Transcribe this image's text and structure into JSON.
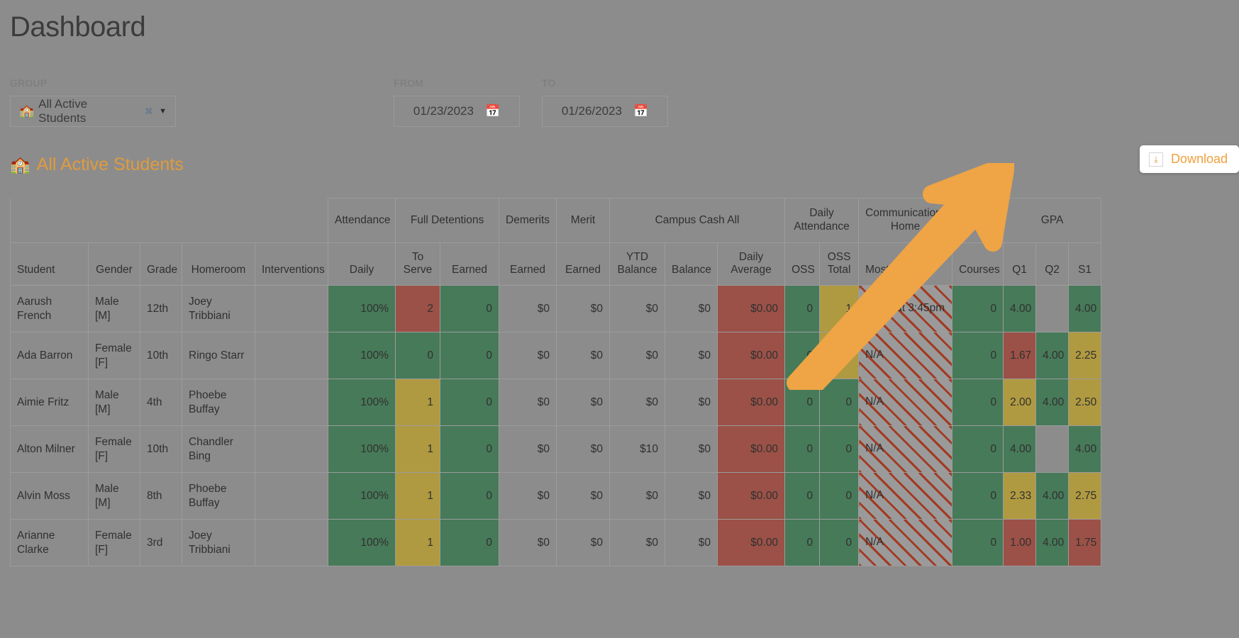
{
  "page": {
    "title": "Dashboard"
  },
  "filters": {
    "group": {
      "label": "GROUP",
      "value": "All Active Students",
      "icon": "school-building-icon",
      "clear": "✖",
      "caret": "▼"
    },
    "from": {
      "label": "FROM",
      "value": "01/23/2023",
      "icon": "calendar-icon"
    },
    "to": {
      "label": "TO",
      "value": "01/26/2023",
      "icon": "calendar-icon"
    }
  },
  "section": {
    "title": "All Active Students",
    "icon": "school-building-icon"
  },
  "download": {
    "label": "Download",
    "icon": "download-icon",
    "glyph": "⤓"
  },
  "table": {
    "group_headers": [
      {
        "label": "",
        "span": 5
      },
      {
        "label": "Attendance",
        "span": 1
      },
      {
        "label": "Full Detentions",
        "span": 2
      },
      {
        "label": "Demerits",
        "span": 1
      },
      {
        "label": "Merit",
        "span": 1
      },
      {
        "label": "Campus Cash All",
        "span": 3
      },
      {
        "label": "Daily Attendance",
        "span": 2
      },
      {
        "label": "Communications Home",
        "span": 1
      },
      {
        "label": "",
        "span": 1
      },
      {
        "label": "GPA",
        "span": 3
      }
    ],
    "columns": [
      "Student",
      "Gender",
      "Grade",
      "Homeroom",
      "Interventions",
      "Daily",
      "To Serve",
      "Earned",
      "Earned",
      "Earned",
      "YTD Balance",
      "Balance",
      "Daily Average",
      "OSS",
      "OSS Total",
      "Most Recent",
      "Courses",
      "Q1",
      "Q2",
      "S1"
    ],
    "rows": [
      {
        "student": "Aarush French",
        "gender": "Male [M]",
        "grade": "12th",
        "homeroom": "Joey Tribbiani",
        "interventions": "",
        "daily": "100%",
        "to_serve": "2",
        "det_earned": "0",
        "demerits": "$0",
        "merit": "$0",
        "ytd_balance": "$0",
        "balance": "$0",
        "daily_average": "$0.00",
        "oss": "0",
        "oss_total": "1",
        "most_recent": "10/21 at 3:45pm",
        "courses": "0",
        "q1": "4.00",
        "q2": "",
        "s1": "4.00",
        "colors": {
          "daily": "g",
          "to_serve": "r",
          "det_earned": "g",
          "daily_average": "r",
          "oss": "g",
          "oss_total": "y",
          "courses": "g",
          "q1": "g",
          "q2": "n",
          "s1": "g"
        }
      },
      {
        "student": "Ada Barron",
        "gender": "Female [F]",
        "grade": "10th",
        "homeroom": "Ringo Starr",
        "interventions": "",
        "daily": "100%",
        "to_serve": "0",
        "det_earned": "0",
        "demerits": "$0",
        "merit": "$0",
        "ytd_balance": "$0",
        "balance": "$0",
        "daily_average": "$0.00",
        "oss": "0",
        "oss_total": "1",
        "most_recent": "N/A",
        "courses": "0",
        "q1": "1.67",
        "q2": "4.00",
        "s1": "2.25",
        "colors": {
          "daily": "g",
          "to_serve": "g",
          "det_earned": "g",
          "daily_average": "r",
          "oss": "g",
          "oss_total": "y",
          "courses": "g",
          "q1": "r",
          "q2": "g",
          "s1": "y"
        }
      },
      {
        "student": "Aimie Fritz",
        "gender": "Male [M]",
        "grade": "4th",
        "homeroom": "Phoebe Buffay",
        "interventions": "",
        "daily": "100%",
        "to_serve": "1",
        "det_earned": "0",
        "demerits": "$0",
        "merit": "$0",
        "ytd_balance": "$0",
        "balance": "$0",
        "daily_average": "$0.00",
        "oss": "0",
        "oss_total": "0",
        "most_recent": "N/A",
        "courses": "0",
        "q1": "2.00",
        "q2": "4.00",
        "s1": "2.50",
        "colors": {
          "daily": "g",
          "to_serve": "y",
          "det_earned": "g",
          "daily_average": "r",
          "oss": "g",
          "oss_total": "g",
          "courses": "g",
          "q1": "y",
          "q2": "g",
          "s1": "y"
        }
      },
      {
        "student": "Alton Milner",
        "gender": "Female [F]",
        "grade": "10th",
        "homeroom": "Chandler Bing",
        "interventions": "",
        "daily": "100%",
        "to_serve": "1",
        "det_earned": "0",
        "demerits": "$0",
        "merit": "$0",
        "ytd_balance": "$10",
        "balance": "$0",
        "daily_average": "$0.00",
        "oss": "0",
        "oss_total": "0",
        "most_recent": "N/A",
        "courses": "0",
        "q1": "4.00",
        "q2": "",
        "s1": "4.00",
        "colors": {
          "daily": "g",
          "to_serve": "y",
          "det_earned": "g",
          "daily_average": "r",
          "oss": "g",
          "oss_total": "g",
          "courses": "g",
          "q1": "g",
          "q2": "n",
          "s1": "g"
        }
      },
      {
        "student": "Alvin Moss",
        "gender": "Male [M]",
        "grade": "8th",
        "homeroom": "Phoebe Buffay",
        "interventions": "",
        "daily": "100%",
        "to_serve": "1",
        "det_earned": "0",
        "demerits": "$0",
        "merit": "$0",
        "ytd_balance": "$0",
        "balance": "$0",
        "daily_average": "$0.00",
        "oss": "0",
        "oss_total": "0",
        "most_recent": "N/A",
        "courses": "0",
        "q1": "2.33",
        "q2": "4.00",
        "s1": "2.75",
        "colors": {
          "daily": "g",
          "to_serve": "y",
          "det_earned": "g",
          "daily_average": "r",
          "oss": "g",
          "oss_total": "g",
          "courses": "g",
          "q1": "y",
          "q2": "g",
          "s1": "y"
        }
      },
      {
        "student": "Arianne Clarke",
        "gender": "Female [F]",
        "grade": "3rd",
        "homeroom": "Joey Tribbiani",
        "interventions": "",
        "daily": "100%",
        "to_serve": "1",
        "det_earned": "0",
        "demerits": "$0",
        "merit": "$0",
        "ytd_balance": "$0",
        "balance": "$0",
        "daily_average": "$0.00",
        "oss": "0",
        "oss_total": "0",
        "most_recent": "N/A",
        "courses": "0",
        "q1": "1.00",
        "q2": "4.00",
        "s1": "1.75",
        "colors": {
          "daily": "g",
          "to_serve": "y",
          "det_earned": "g",
          "daily_average": "r",
          "oss": "g",
          "oss_total": "g",
          "courses": "g",
          "q1": "r",
          "q2": "g",
          "s1": "r"
        }
      }
    ]
  },
  "colors": {
    "accent_orange": "#e09b3d",
    "page_bg": "#8c8c8c",
    "green": "#477a59",
    "red": "#9b5147",
    "yellow": "#b09a41",
    "hatch_line": "#a33a22",
    "arrow": "#efa445"
  }
}
